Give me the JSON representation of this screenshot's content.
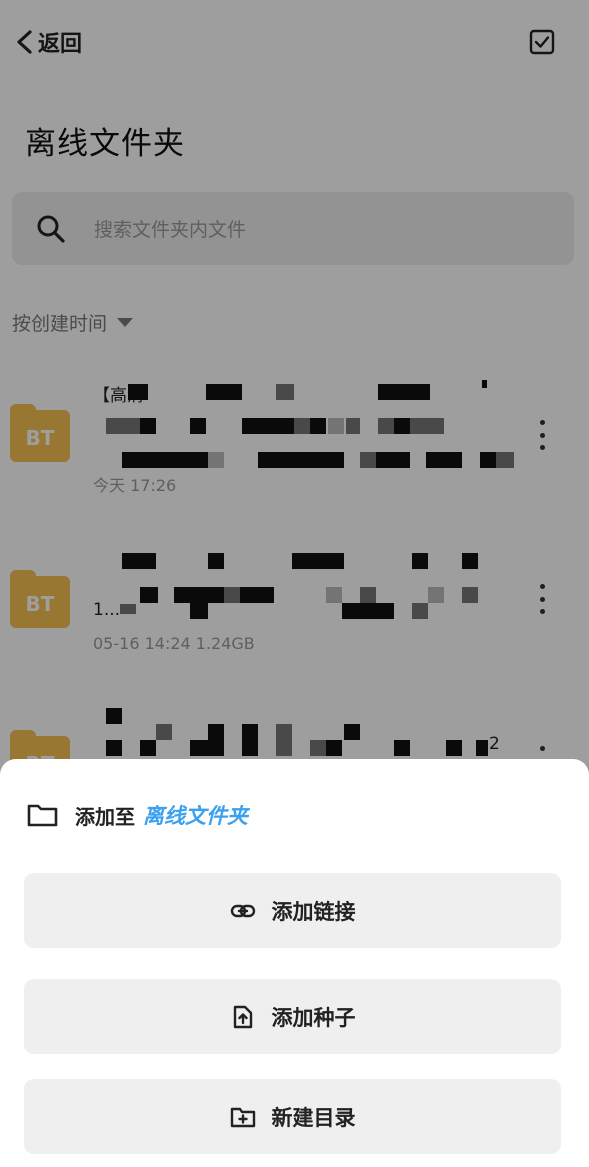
{
  "header": {
    "back_label": "返回",
    "title": "离线文件夹"
  },
  "search": {
    "placeholder": "搜索文件夹内文件"
  },
  "sort": {
    "label": "按创建时间"
  },
  "files": [
    {
      "badge": "BT",
      "name_visible": "【高清",
      "meta": "今天 17:26"
    },
    {
      "badge": "BT",
      "name_visible": "1...",
      "meta": "05-16 14:24   1.24GB"
    },
    {
      "badge": "BT",
      "name_visible": "2",
      "meta": ""
    }
  ],
  "sheet": {
    "prefix": "添加至",
    "target": "离线文件夹",
    "actions": [
      {
        "label": "添加链接",
        "icon": "link-icon"
      },
      {
        "label": "添加种子",
        "icon": "file-upload-icon"
      },
      {
        "label": "新建目录",
        "icon": "folder-plus-icon"
      }
    ]
  },
  "colors": {
    "folder": "#f5c153",
    "accent": "#3aa0f0",
    "button_bg": "#efefef"
  }
}
